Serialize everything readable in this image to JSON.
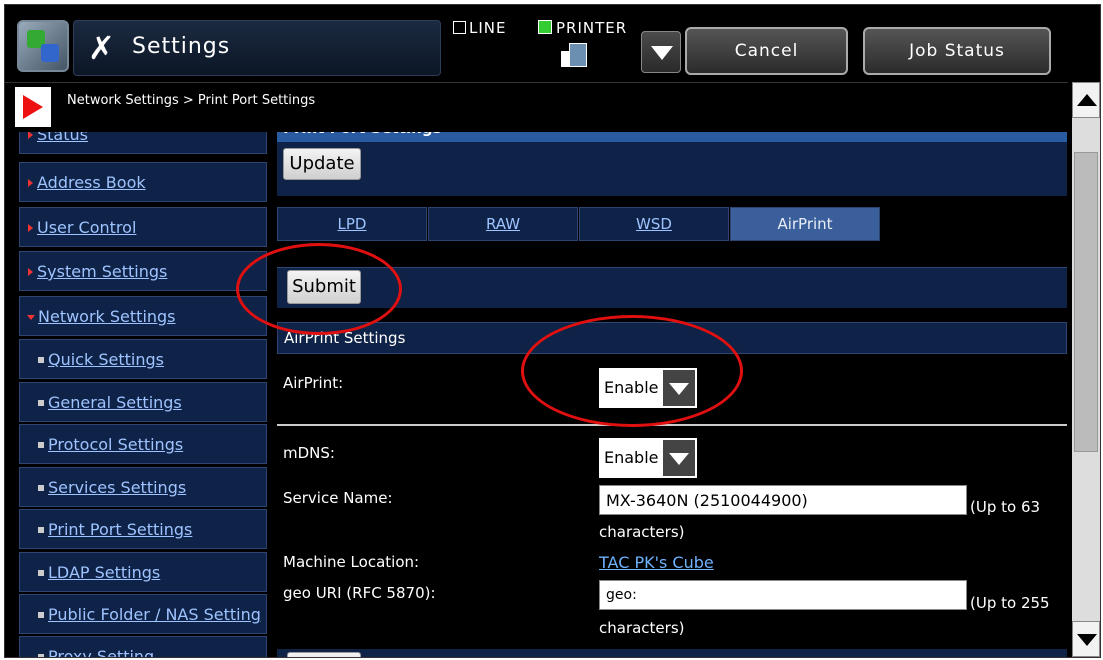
{
  "topbar": {
    "title": "Settings",
    "mode_line": "LINE",
    "mode_printer": "PRINTER",
    "cancel_label": "Cancel",
    "job_status_label": "Job Status"
  },
  "breadcrumb": "Network Settings > Print Port Settings",
  "sidebar": {
    "items": [
      {
        "label": "Status"
      },
      {
        "label": "Address Book"
      },
      {
        "label": "User Control"
      },
      {
        "label": "System Settings"
      },
      {
        "label": "Network Settings"
      },
      {
        "label": "Quick Settings"
      },
      {
        "label": "General Settings"
      },
      {
        "label": "Protocol Settings"
      },
      {
        "label": "Services Settings"
      },
      {
        "label": "Print Port Settings"
      },
      {
        "label": "LDAP Settings"
      },
      {
        "label": "Public Folder / NAS Setting"
      },
      {
        "label": "Proxy Setting"
      }
    ]
  },
  "main": {
    "section_title": "Print Port Settings",
    "update_label": "Update",
    "tabs": [
      {
        "label": "LPD"
      },
      {
        "label": "RAW"
      },
      {
        "label": "WSD"
      },
      {
        "label": "AirPrint",
        "active": true
      }
    ],
    "submit_label": "Submit",
    "airprint_heading": "AirPrint Settings",
    "airprint_label": "AirPrint:",
    "airprint_value": "Enable",
    "mdns_label": "mDNS:",
    "mdns_value": "Enable",
    "service_name_label": "Service Name:",
    "service_name_value": "MX-3640N (2510044900)",
    "service_name_hint": "(Up to 63",
    "service_name_hint2": "characters)",
    "machine_location_label": "Machine Location:",
    "machine_location_value": "TAC PK's Cube",
    "geo_uri_label": "geo URI (RFC 5870):",
    "geo_uri_value": "geo:",
    "geo_uri_hint": "(Up to 255",
    "geo_uri_hint2": "characters)"
  },
  "colors": {
    "panel": "#0e2347",
    "tab_active": "#3b5f9a",
    "link": "#9fc3ff",
    "annotation": "#e01010"
  }
}
